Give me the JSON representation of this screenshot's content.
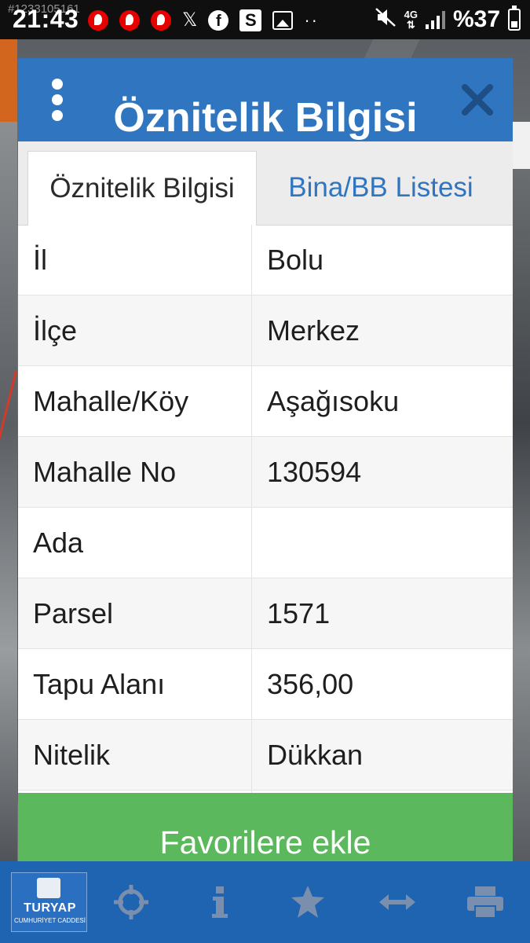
{
  "status_bar": {
    "watermark": "#1233105161",
    "time": "21:43",
    "network": "4G",
    "battery": "%37",
    "icons": [
      "vodafone-icon",
      "vodafone-icon",
      "vodafone-icon",
      "x-icon",
      "facebook-icon",
      "s-app-icon",
      "image-icon",
      "more-dots-icon",
      "mute-icon",
      "signal-icon",
      "battery-icon"
    ]
  },
  "dialog": {
    "title": "Öznitelik Bilgisi",
    "tabs": [
      {
        "label": "Öznitelik Bilgisi",
        "active": true
      },
      {
        "label": "Bina/BB Listesi",
        "active": false
      }
    ],
    "rows": [
      {
        "key": "İl",
        "value": "Bolu"
      },
      {
        "key": "İlçe",
        "value": "Merkez"
      },
      {
        "key": "Mahalle/Köy",
        "value": "Aşağısoku"
      },
      {
        "key": "Mahalle No",
        "value": "130594"
      },
      {
        "key": "Ada",
        "value": ""
      },
      {
        "key": "Parsel",
        "value": "1571"
      },
      {
        "key": "Tapu Alanı",
        "value": "356,00"
      },
      {
        "key": "Nitelik",
        "value": "Dükkan"
      }
    ],
    "favorite_button": "Favorilere ekle"
  },
  "logo": {
    "main": "TURYAP",
    "sub": "CUMHURİYET CADDESİ"
  },
  "bottom_bar": {
    "icons": [
      "crosshair-icon",
      "info-icon",
      "star-icon",
      "measure-icon",
      "print-icon"
    ]
  },
  "colors": {
    "header_blue": "#2f75bf",
    "button_green": "#5cb85c",
    "bottom_bar_blue": "#1f64b1"
  }
}
